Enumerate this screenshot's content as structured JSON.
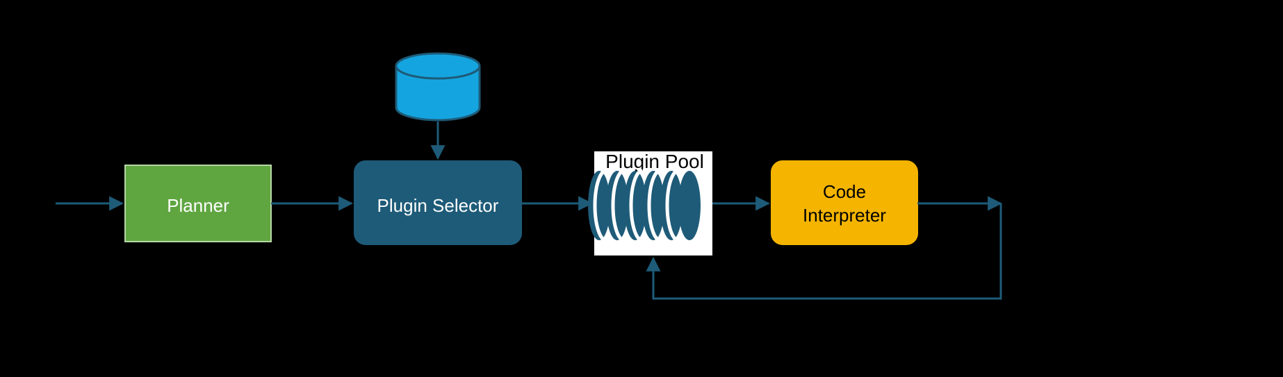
{
  "nodes": {
    "planner": {
      "label": "Planner"
    },
    "pluginSelector": {
      "label": "Plugin Selector"
    },
    "pluginPool": {
      "label": "Plugin Pool"
    },
    "codeInterp": {
      "label_line1": "Code",
      "label_line2": "Interpreter"
    }
  },
  "colors": {
    "plannerFill": "#5FA641",
    "plannerStroke": "#B8D6A6",
    "selectorFill": "#1E5B78",
    "accentStroke": "#1E5B78",
    "cylinderFill": "#14A5E0",
    "codeFill": "#F4B400",
    "whiteBg": "#FFFFFF",
    "blackText": "#000000",
    "whiteText": "#FFFFFF"
  }
}
